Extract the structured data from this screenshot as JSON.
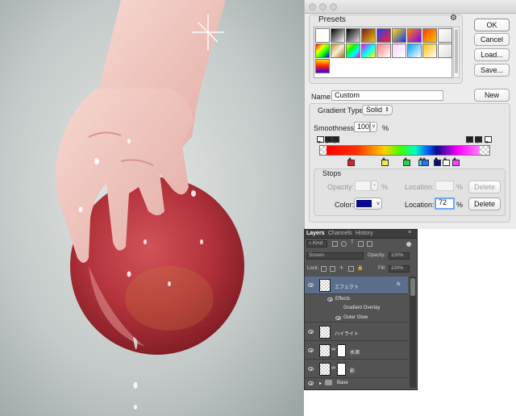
{
  "dialog": {
    "presets_label": "Presets",
    "gear_icon": "gear-icon",
    "buttons": {
      "ok": "OK",
      "cancel": "Cancel",
      "load": "Load...",
      "save": "Save...",
      "new": "New",
      "delete": "Delete"
    },
    "name_label": "Name:",
    "name_value": "Custom",
    "gradient_type_label": "Gradient Type:",
    "gradient_type_value": "Solid",
    "smoothness_label": "Smoothness:",
    "smoothness_value": "100",
    "smoothness_unit": "%",
    "stops_label": "Stops",
    "opacity_label": "Opacity:",
    "opacity_unit": "%",
    "location_label": "Location:",
    "location_unit": "%",
    "color_label": "Color:",
    "color_value": "#0a0a8c",
    "location_value": "72",
    "presets": [
      "#ffffff",
      "linear-gradient(135deg,#000,#fff)",
      "linear-gradient(135deg,#000,#e0e0e0)",
      "linear-gradient(135deg,#7a1a10,#e8c020)",
      "linear-gradient(135deg,#2040ff,#ff2020)",
      "linear-gradient(135deg,#ffe000,#1030ff)",
      "linear-gradient(135deg,#ff8000,#8000ff)",
      "linear-gradient(135deg,#ff4000,#ffc000)",
      "linear-gradient(135deg,#ffffff,#e0e0e0)",
      "linear-gradient(135deg,#ff0000,#ffff00,#00ff00,#0000ff)",
      "linear-gradient(135deg,#c09030,#f8f0d0,#a07020)",
      "linear-gradient(135deg,#ff0,#0f0,#0ff,#f0f)",
      "linear-gradient(135deg,#ff00ff,#00ffff,#ffff00)",
      "linear-gradient(135deg,#ff8080,#ffffff)",
      "linear-gradient(135deg,#ffd0ff,#ffffff)",
      "linear-gradient(135deg,#00a0ff,#ffffff)",
      "linear-gradient(135deg,#ffc000,#ffffff)",
      "linear-gradient(135deg,#ffffff,#dddddd)",
      "linear-gradient(180deg,#ffe000,#ff2000,#3000ff)"
    ],
    "gradient_bar": "linear-gradient(90deg,#ff0000 0%,#ff3000 20%,#ffd000 38%,#40ff00 48%,#00ffc0 58%,#0060ff 66%,#0a0a8c 72%,#ff00ff 86%,#ff80ff 100%)",
    "color_stops": [
      {
        "color": "#e0202a",
        "location": 16
      },
      {
        "color": "#f6e64a",
        "location": 38
      },
      {
        "color": "#2ad44a",
        "location": 52
      },
      {
        "color": "#30d8e0",
        "location": 62
      },
      {
        "color": "#2070ff",
        "location": 64
      },
      {
        "color": "#0a0a8c",
        "location": 72
      },
      {
        "color": "#ffffff",
        "location": 78
      },
      {
        "color": "#ff40ff",
        "location": 84
      }
    ],
    "opacity_stops": [
      {
        "color": "#ffffff",
        "location": 0
      },
      {
        "color": "#222222",
        "location": 5
      },
      {
        "color": "#222222",
        "location": 9
      },
      {
        "color": "#222222",
        "location": 89
      },
      {
        "color": "#222222",
        "location": 94
      },
      {
        "color": "#ffffff",
        "location": 100
      }
    ]
  },
  "layers": {
    "tabs": [
      "Layers",
      "Channels",
      "History"
    ],
    "filter_value": "Kind",
    "blend_mode": "Screen",
    "opacity_label": "Opacity:",
    "opacity_value": "100%",
    "lock_label": "Lock:",
    "fill_label": "Fill:",
    "fill_value": "100%",
    "fx_label": "fx",
    "rows": [
      {
        "name": "エフェクト",
        "active": true,
        "mask": false
      },
      {
        "name": "ハイライト",
        "active": false,
        "mask": false
      },
      {
        "name": "水滴",
        "active": false,
        "mask": true
      },
      {
        "name": "影",
        "active": false,
        "mask": true
      }
    ],
    "effects_label": "Effects",
    "effect_items": [
      "Gradient Overlay",
      "Outer Glow"
    ],
    "group_name": "Base"
  },
  "colors": {
    "dialog_bg": "#ececec",
    "panel_bg": "#535353",
    "selected_layer": "#5b6f8c",
    "apple_red": "#b8323a",
    "skin": "#f1c8c0",
    "background_gray": "#c9cccc"
  }
}
